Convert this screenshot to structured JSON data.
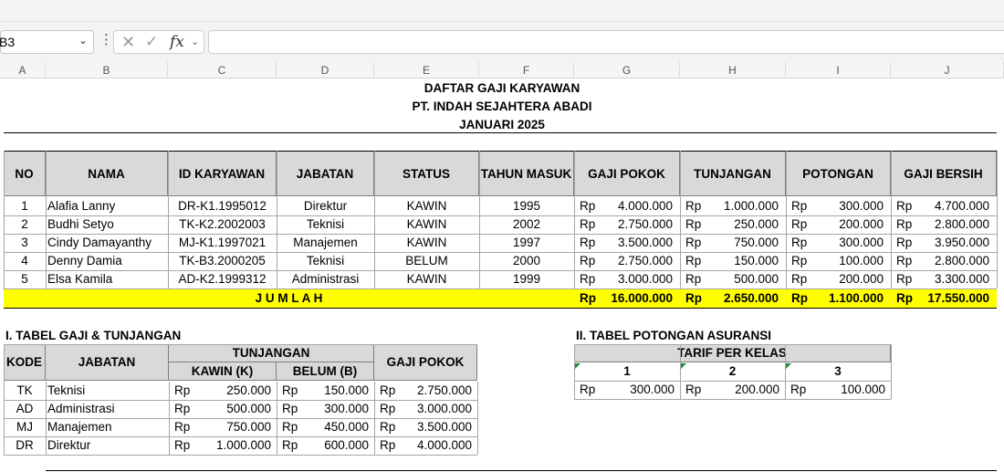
{
  "formula_bar": {
    "name_box": "B3",
    "fx_label": "fx",
    "formula": ""
  },
  "columns": [
    "A",
    "B",
    "C",
    "D",
    "E",
    "F",
    "G",
    "H",
    "I",
    "J"
  ],
  "titles": [
    "DAFTAR GAJI KARYAWAN",
    "PT. INDAH SEJAHTERA ABADI",
    "JANUARI 2025"
  ],
  "main_table": {
    "headers": [
      "NO",
      "NAMA",
      "ID KARYAWAN",
      "JABATAN",
      "STATUS",
      "TAHUN MASUK",
      "GAJI POKOK",
      "TUNJANGAN",
      "POTONGAN",
      "GAJI BERSIH"
    ],
    "currency": "Rp",
    "rows": [
      {
        "no": "1",
        "nama": "Alafia Lanny",
        "id": "DR-K1.1995012",
        "jabatan": "Direktur",
        "status": "KAWIN",
        "tahun": "1995",
        "gaji": "4.000.000",
        "tunjangan": "1.000.000",
        "potongan": "300.000",
        "bersih": "4.700.000"
      },
      {
        "no": "2",
        "nama": "Budhi Setyo",
        "id": "TK-K2.2002003",
        "jabatan": "Teknisi",
        "status": "KAWIN",
        "tahun": "2002",
        "gaji": "2.750.000",
        "tunjangan": "250.000",
        "potongan": "200.000",
        "bersih": "2.800.000"
      },
      {
        "no": "3",
        "nama": "Cindy Damayanthy",
        "id": "MJ-K1.1997021",
        "jabatan": "Manajemen",
        "status": "KAWIN",
        "tahun": "1997",
        "gaji": "3.500.000",
        "tunjangan": "750.000",
        "potongan": "300.000",
        "bersih": "3.950.000"
      },
      {
        "no": "4",
        "nama": "Denny Damia",
        "id": "TK-B3.2000205",
        "jabatan": "Teknisi",
        "status": "BELUM",
        "tahun": "2000",
        "gaji": "2.750.000",
        "tunjangan": "150.000",
        "potongan": "100.000",
        "bersih": "2.800.000"
      },
      {
        "no": "5",
        "nama": "Elsa Kamila",
        "id": "AD-K2.1999312",
        "jabatan": "Administrasi",
        "status": "KAWIN",
        "tahun": "1999",
        "gaji": "3.000.000",
        "tunjangan": "500.000",
        "potongan": "200.000",
        "bersih": "3.300.000"
      }
    ],
    "total": {
      "label": "J U M L A H",
      "gaji": "16.000.000",
      "tunjangan": "2.650.000",
      "potongan": "1.100.000",
      "bersih": "17.550.000"
    }
  },
  "table1": {
    "title": "I. TABEL GAJI & TUNJANGAN",
    "headers": {
      "kode": "KODE",
      "jabatan": "JABATAN",
      "tunjangan": "TUNJANGAN",
      "kawin": "KAWIN (K)",
      "belum": "BELUM (B)",
      "gaji": "GAJI POKOK"
    },
    "rows": [
      {
        "kode": "TK",
        "jabatan": "Teknisi",
        "kawin": "250.000",
        "belum": "150.000",
        "gaji": "2.750.000"
      },
      {
        "kode": "AD",
        "jabatan": "Administrasi",
        "kawin": "500.000",
        "belum": "300.000",
        "gaji": "3.000.000"
      },
      {
        "kode": "MJ",
        "jabatan": "Manajemen",
        "kawin": "750.000",
        "belum": "450.000",
        "gaji": "3.500.000"
      },
      {
        "kode": "DR",
        "jabatan": "Direktur",
        "kawin": "1.000.000",
        "belum": "600.000",
        "gaji": "4.000.000"
      }
    ]
  },
  "table2": {
    "title": "II. TABEL POTONGAN ASURANSI",
    "header": "TARIF PER KELAS",
    "classes": [
      "1",
      "2",
      "3"
    ],
    "values": [
      "300.000",
      "200.000",
      "100.000"
    ]
  },
  "colors": {
    "header_gray": "#d9d9d9",
    "total_yellow": "#ffff00",
    "indicator_green": "#1e8c3a"
  }
}
